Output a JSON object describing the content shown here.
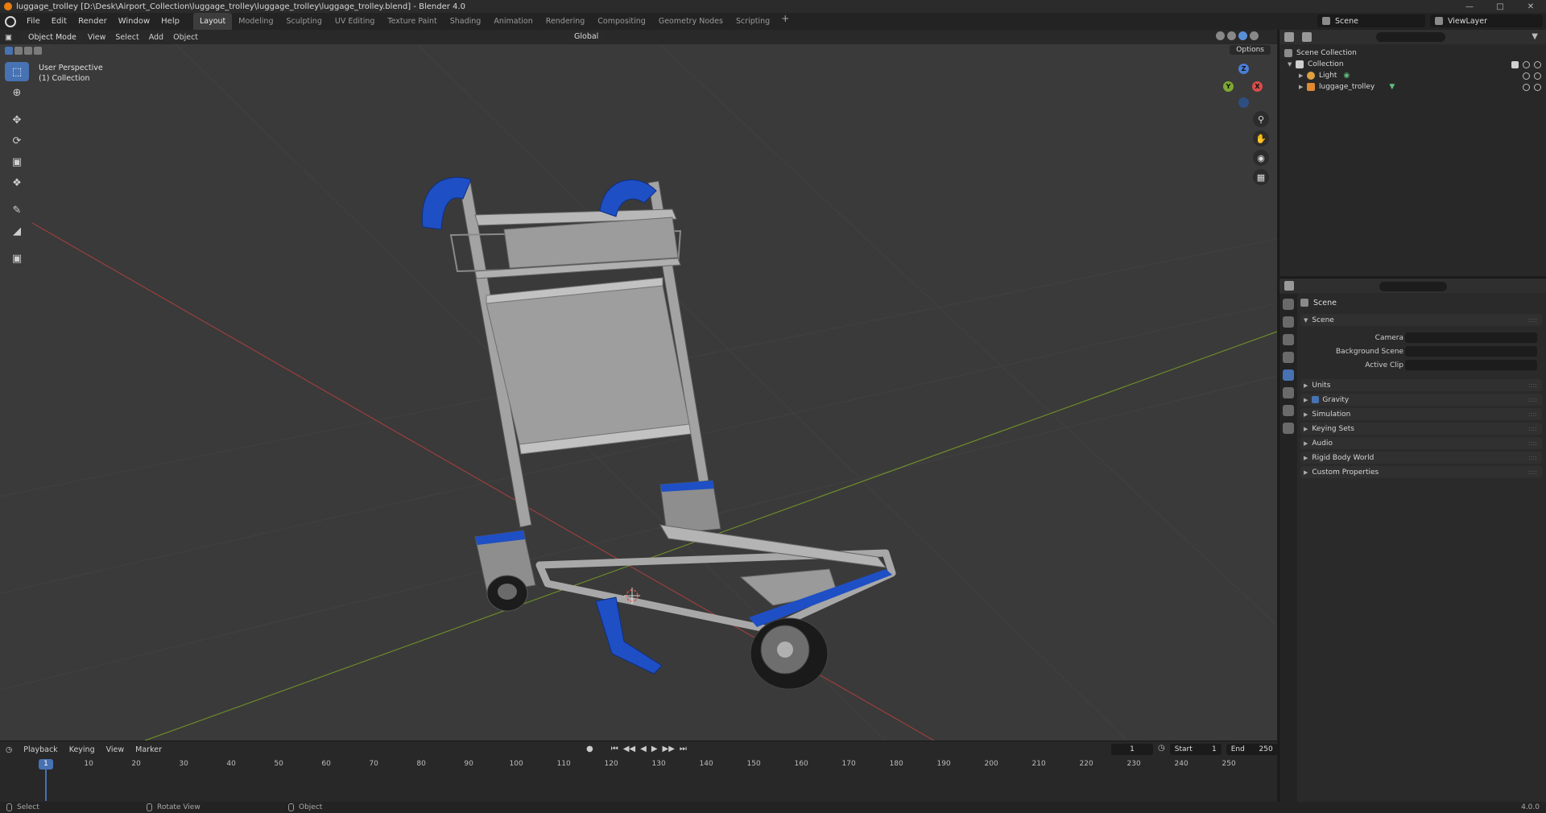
{
  "window": {
    "title": "luggage_trolley [D:\\Desk\\Airport_Collection\\luggage_trolley\\luggage_trolley\\luggage_trolley.blend] - Blender 4.0"
  },
  "menu": {
    "items": [
      "File",
      "Edit",
      "Render",
      "Window",
      "Help"
    ]
  },
  "workspaces": {
    "tabs": [
      "Layout",
      "Modeling",
      "Sculpting",
      "UV Editing",
      "Texture Paint",
      "Shading",
      "Animation",
      "Rendering",
      "Compositing",
      "Geometry Nodes",
      "Scripting"
    ],
    "active": "Layout",
    "add": "+"
  },
  "scene_selector": {
    "value": "Scene"
  },
  "viewlayer_selector": {
    "value": "ViewLayer"
  },
  "viewport": {
    "mode": "Object Mode",
    "menus": [
      "View",
      "Select",
      "Add",
      "Object"
    ],
    "transform_orientation": "Global",
    "options_label": "Options",
    "info_line1": "User Perspective",
    "info_line2": "(1) Collection",
    "gizmo": {
      "z": "Z",
      "x": "X",
      "y": "Y"
    }
  },
  "toolbar": {
    "tools": [
      "select-box",
      "cursor",
      "move",
      "rotate",
      "scale",
      "transform",
      "annotate",
      "measure",
      "add-cube"
    ]
  },
  "timeline": {
    "menus": [
      "Playback",
      "Keying",
      "View",
      "Marker"
    ],
    "current_frame": "1",
    "start_label": "Start",
    "start": "1",
    "end_label": "End",
    "end": "250",
    "ticks": [
      "10",
      "20",
      "30",
      "40",
      "50",
      "60",
      "70",
      "80",
      "90",
      "100",
      "110",
      "120",
      "130",
      "140",
      "150",
      "160",
      "170",
      "180",
      "190",
      "200",
      "210",
      "220",
      "230",
      "240",
      "250"
    ]
  },
  "statusbar": {
    "select": "Select",
    "rotate": "Rotate View",
    "object": "Object",
    "version": "4.0.0"
  },
  "outliner": {
    "root": "Scene Collection",
    "collection": "Collection",
    "items": [
      "Light",
      "luggage_trolley"
    ]
  },
  "properties": {
    "context": "Scene",
    "scene_panel": "Scene",
    "fields": {
      "camera": "Camera",
      "background_scene": "Background Scene",
      "active_clip": "Active Clip"
    },
    "panels": [
      "Units",
      "Gravity",
      "Simulation",
      "Keying Sets",
      "Audio",
      "Rigid Body World",
      "Custom Properties"
    ]
  },
  "colors": {
    "accent": "#4772b3",
    "trolley_blue": "#1f4fc4",
    "trolley_metal": "#9a9a9a",
    "grid_x": "#b04545",
    "grid_y": "#7d9a32"
  }
}
